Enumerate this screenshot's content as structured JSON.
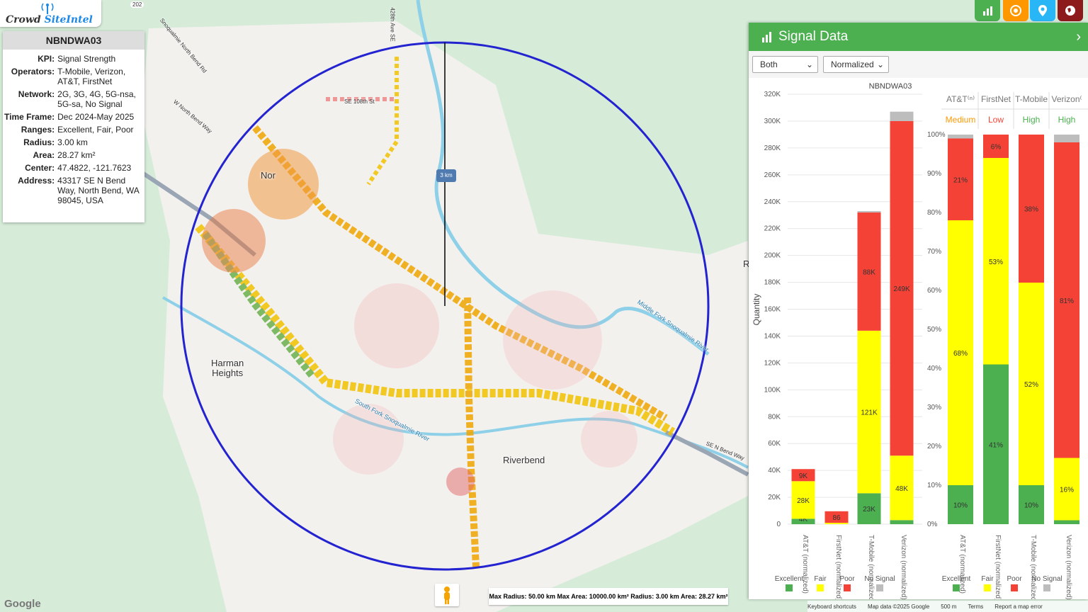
{
  "app": {
    "logo_left": "Crowd",
    "logo_right": "SiteIntel"
  },
  "info": {
    "site": "NBNDWA03",
    "rows": [
      {
        "k": "KPI:",
        "v": "Signal Strength"
      },
      {
        "k": "Operators:",
        "v": "T-Mobile, Verizon, AT&T, FirstNet"
      },
      {
        "k": "Network:",
        "v": "2G, 3G, 4G, 5G-nsa, 5G-sa, No Signal"
      },
      {
        "k": "Time Frame:",
        "v": "Dec 2024-May 2025"
      },
      {
        "k": "Ranges:",
        "v": "Excellent, Fair, Poor"
      },
      {
        "k": "Radius:",
        "v": "3.00 km"
      },
      {
        "k": "Area:",
        "v": "28.27 km²"
      },
      {
        "k": "Center:",
        "v": "47.4822, -121.7623"
      },
      {
        "k": "Address:",
        "v": "43317 SE N Bend Way, North Bend, WA 98045, USA"
      }
    ]
  },
  "toolbar": {
    "icons": [
      "bar-chart-icon",
      "target-icon",
      "map-pin-icon",
      "globe-icon"
    ],
    "colors": [
      "#4caf50",
      "#ff9800",
      "#29b6f6",
      "#8e1b1b"
    ]
  },
  "map": {
    "radius_label": "3 km",
    "labels": {
      "harman": "Harman\nHeights",
      "riverbend": "Riverbend",
      "north_bend": "Nor",
      "middle_fork": "Middle Fork Snoqualmie River",
      "south_fork": "South Fork Snoqualmie River",
      "se_n_bend_way": "SE N Bend Way",
      "w_north_bend": "W North Bend Way",
      "snoq_north_bend": "Snoqualmie North Bend Rd",
      "ave_428": "428th Ave SE",
      "r_edge": "R",
      "hwy_202": "202",
      "se_street": "SE 108th St"
    }
  },
  "scale_box": {
    "text": "Max Radius: 50.00 km Max Area: 10000.00 km² Radius: 3.00 km Area: 28.27 km²"
  },
  "attribution": {
    "google": "Google",
    "shortcuts": "Keyboard shortcuts",
    "mapdata": "Map data ©2025 Google",
    "scale": "500 m",
    "terms": "Terms",
    "report": "Report a map error"
  },
  "panel": {
    "title": "Signal Data",
    "select_mode": "Both",
    "select_norm": "Normalized",
    "chart_title": "NBNDWA03",
    "ylabel": "Quantity",
    "operators_header": [
      "AT&T⁽ⁿ⁾",
      "FirstNet",
      "T-Mobile",
      "Verizon⁽"
    ],
    "ratings": [
      "Medium",
      "Low",
      "High",
      "High"
    ],
    "rating_colors": [
      "#ff9800",
      "#f44336",
      "#4caf50",
      "#4caf50"
    ],
    "legend": [
      "Excellent",
      "Fair",
      "Poor",
      "No Signal"
    ]
  },
  "chart_data": [
    {
      "type": "bar",
      "stacked": true,
      "title": "NBNDWA03",
      "ylabel": "Quantity",
      "categories": [
        "AT&T (normalized)",
        "FirstNet (normalized)",
        "T-Mobile (normalized)",
        "Verizon (normalized)"
      ],
      "ylim": [
        0,
        320000
      ],
      "yticks": [
        "0",
        "20K",
        "40K",
        "60K",
        "80K",
        "100K",
        "120K",
        "140K",
        "160K",
        "180K",
        "200K",
        "220K",
        "240K",
        "260K",
        "280K",
        "300K",
        "320K"
      ],
      "series": [
        {
          "name": "Excellent",
          "color": "#4caf50",
          "values": [
            4000,
            0,
            23000,
            3000
          ],
          "labels": [
            "4K",
            "",
            "23K",
            ""
          ]
        },
        {
          "name": "Fair",
          "color": "#ffff00",
          "values": [
            28000,
            1000,
            121000,
            48000
          ],
          "labels": [
            "28K",
            "",
            "121K",
            "48K"
          ]
        },
        {
          "name": "Poor",
          "color": "#f44336",
          "values": [
            9000,
            8600,
            88000,
            249000
          ],
          "labels": [
            "9K",
            "86",
            "88K",
            "249K"
          ]
        },
        {
          "name": "No Signal",
          "color": "#bdbdbd",
          "values": [
            0,
            0,
            1000,
            7000
          ],
          "labels": [
            "",
            "",
            "",
            ""
          ]
        }
      ]
    },
    {
      "type": "bar",
      "stacked": true,
      "percent": true,
      "categories": [
        "AT&T (normalized)",
        "FirstNet (normalized)",
        "T-Mobile (normalized)",
        "Verizon (normalized)"
      ],
      "ylim": [
        0,
        100
      ],
      "yticks": [
        "0%",
        "10%",
        "20%",
        "30%",
        "40%",
        "50%",
        "60%",
        "70%",
        "80%",
        "90%",
        "100%"
      ],
      "series": [
        {
          "name": "Excellent",
          "color": "#4caf50",
          "values": [
            10,
            41,
            10,
            1
          ],
          "labels": [
            "10%",
            "41%",
            "10%",
            ""
          ]
        },
        {
          "name": "Fair",
          "color": "#ffff00",
          "values": [
            68,
            53,
            52,
            16
          ],
          "labels": [
            "68%",
            "53%",
            "52%",
            "16%"
          ]
        },
        {
          "name": "Poor",
          "color": "#f44336",
          "values": [
            21,
            6,
            38,
            81
          ],
          "labels": [
            "21%",
            "6%",
            "38%",
            "81%"
          ]
        },
        {
          "name": "No Signal",
          "color": "#bdbdbd",
          "values": [
            1,
            0,
            0,
            2
          ],
          "labels": [
            "",
            "",
            "",
            ""
          ]
        }
      ]
    }
  ]
}
